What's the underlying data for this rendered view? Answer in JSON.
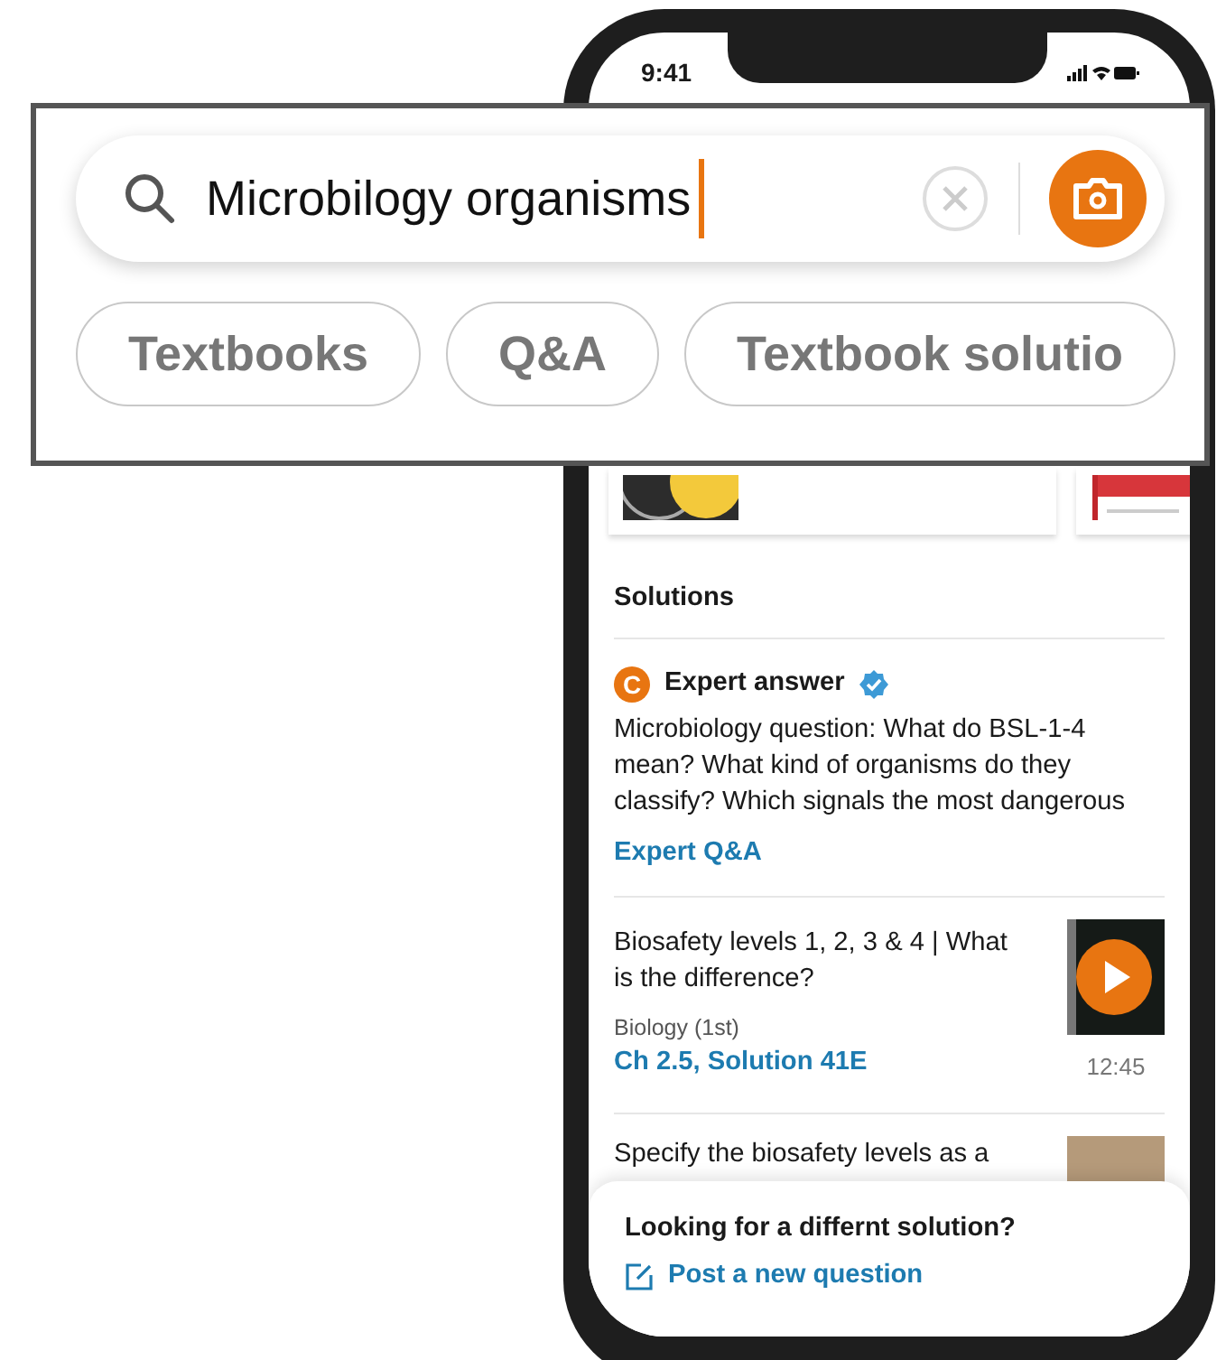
{
  "status_bar": {
    "time": "9:41"
  },
  "search": {
    "value": "Microbilogy organisms"
  },
  "filters": [
    {
      "label": "Textbooks"
    },
    {
      "label": "Q&A"
    },
    {
      "label": "Textbook solutio"
    }
  ],
  "solutions": {
    "heading": "Solutions",
    "items": [
      {
        "kind": "expert",
        "badge": "C",
        "label": "Expert answer",
        "text": "Microbiology question: What do BSL-1-4 mean? What kind of organisms do they classify? Which signals the most dangerous",
        "link": "Expert Q&A"
      },
      {
        "kind": "video",
        "title": "Biosafety levels 1, 2, 3 & 4 | What is the difference?",
        "book": "Biology (1st)",
        "link": "Ch 2.5, Solution 41E",
        "duration": "12:45"
      },
      {
        "kind": "thumb",
        "title": "Specify the biosafety levels as a"
      }
    ]
  },
  "footer": {
    "prompt": "Looking for a differnt solution?",
    "action": "Post a new question"
  }
}
